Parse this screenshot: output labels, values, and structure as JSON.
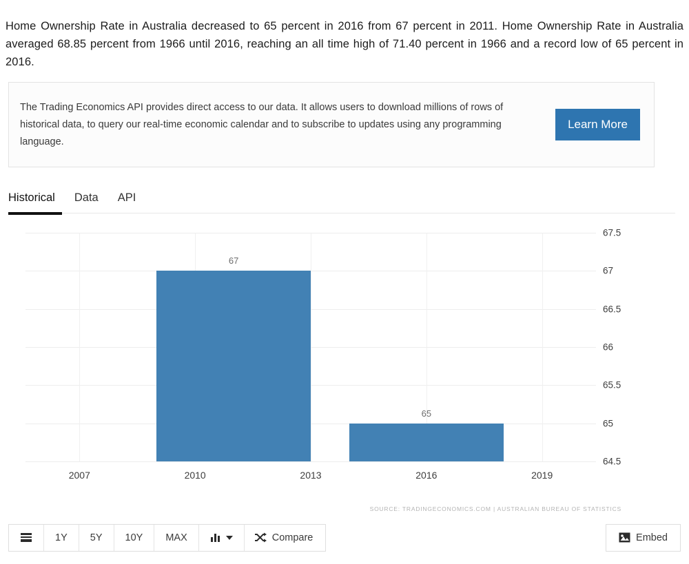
{
  "intro": {
    "paragraph": "Home Ownership Rate in Australia decreased to 65 percent in 2016 from 67 percent in 2011. Home Ownership Rate in Australia averaged 68.85 percent from 1966 until 2016, reaching an all time high of 71.40 percent in 1966 and a record low of 65 percent in 2016."
  },
  "api_panel": {
    "text": "The Trading Economics API provides direct access to our data. It allows users to download millions of rows of historical data, to query our real-time economic calendar and to subscribe to updates using any programming language.",
    "button_label": "Learn More",
    "button_color": "#2e75b0"
  },
  "tabs": [
    {
      "label": "Historical",
      "active": true
    },
    {
      "label": "Data",
      "active": false
    },
    {
      "label": "API",
      "active": false
    }
  ],
  "chart_data": {
    "type": "bar",
    "title": "",
    "subtitle": "",
    "xlabel": "",
    "ylabel": "",
    "categories": [
      "2011",
      "2016"
    ],
    "values": [
      67,
      65
    ],
    "data_labels": [
      "67",
      "65"
    ],
    "series": [
      {
        "name": "Home Ownership Rate",
        "values": [
          67,
          65
        ]
      }
    ],
    "ylim": [
      64.5,
      67.5
    ],
    "ytick_labels": [
      "67.5",
      "67",
      "66.5",
      "66",
      "65.5",
      "65",
      "64.5"
    ],
    "ytick_values": [
      67.5,
      67,
      66.5,
      66,
      65.5,
      65,
      64.5
    ],
    "xtick_labels": [
      "2007",
      "2010",
      "2013",
      "2016",
      "2019"
    ],
    "xlim": [
      2005.6,
      2020.4
    ],
    "grid": true,
    "legend": "none",
    "bar_color": "#4281b4",
    "source": "SOURCE: TRADINGECONOMICS.COM  |  AUSTRALIAN BUREAU OF STATISTICS"
  },
  "toolbar": {
    "list_icon": "list-icon",
    "ranges": [
      "1Y",
      "5Y",
      "10Y",
      "MAX"
    ],
    "chart_type_icon": "bar-chart-icon",
    "chart_type_caret": "▾",
    "compare_icon": "shuffle-icon",
    "compare_label": "Compare",
    "embed_icon": "image-icon",
    "embed_label": "Embed"
  }
}
